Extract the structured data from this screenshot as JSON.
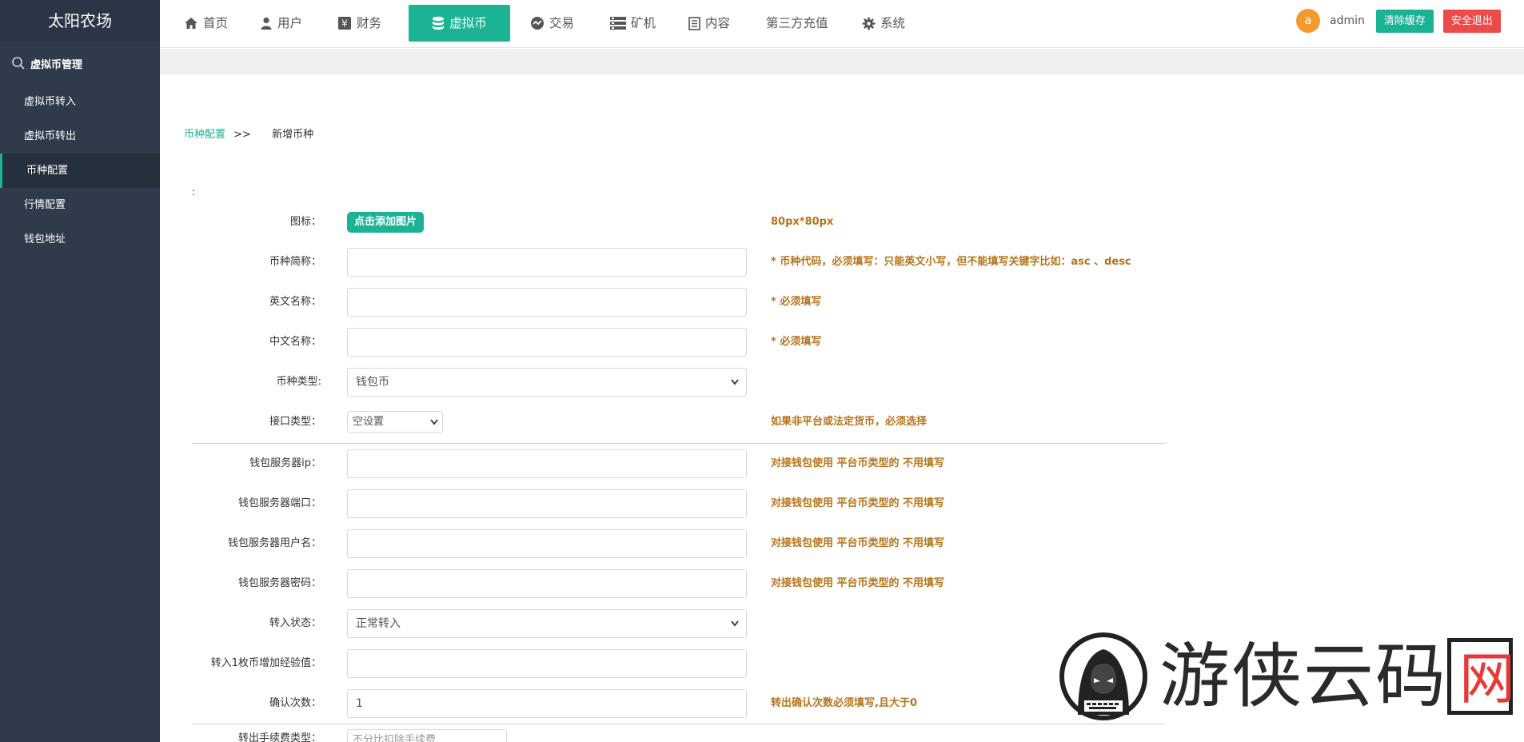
{
  "sidebar": {
    "logo": "太阳农场",
    "section_title": "虚拟币管理",
    "items": [
      {
        "label": "虚拟币转入"
      },
      {
        "label": "虚拟币转出"
      },
      {
        "label": "币种配置"
      },
      {
        "label": "行情配置"
      },
      {
        "label": "钱包地址"
      }
    ]
  },
  "topnav": {
    "items": [
      {
        "label": "首页",
        "icon": "home-icon"
      },
      {
        "label": "用户",
        "icon": "user-icon"
      },
      {
        "label": "财务",
        "icon": "yen-icon"
      },
      {
        "label": "虚拟币",
        "icon": "database-icon"
      },
      {
        "label": "交易",
        "icon": "exchange-icon"
      },
      {
        "label": "矿机",
        "icon": "server-icon"
      },
      {
        "label": "内容",
        "icon": "document-icon"
      },
      {
        "label": "第三方充值",
        "icon": ""
      },
      {
        "label": "系统",
        "icon": "gear-icon"
      }
    ],
    "active": "虚拟币",
    "avatar_letter": "a",
    "username": "admin",
    "clear_cache": "清除缓存",
    "logout": "安全退出"
  },
  "breadcrumb": {
    "link": "币种配置",
    "sep": ">>",
    "current": "新增币种"
  },
  "form": {
    "colon": ":",
    "icon_label": "图标：",
    "icon_button": "点击添加图片",
    "icon_hint": "80px*80px",
    "short_name_label": "币种简称：",
    "short_name_hint": "* 币种代码，必须填写：只能英文小写，但不能填写关键字比如：asc 、desc",
    "en_name_label": "英文名称：",
    "en_name_hint": "* 必须填写",
    "cn_name_label": "中文名称：",
    "cn_name_hint": "* 必须填写",
    "type_label": "币种类型:",
    "type_value": "钱包币",
    "api_label": "接口类型：",
    "api_value": "空设置",
    "api_hint": "如果非平台或法定货币，必须选择",
    "wallet_ip_label": "钱包服务器ip：",
    "wallet_ip_hint": "对接钱包使用 平台币类型的 不用填写",
    "wallet_port_label": "钱包服务器端口：",
    "wallet_port_hint": "对接钱包使用 平台币类型的 不用填写",
    "wallet_user_label": "钱包服务器用户名：",
    "wallet_user_hint": "对接钱包使用 平台币类型的 不用填写",
    "wallet_pass_label": "钱包服务器密码：",
    "wallet_pass_hint": "对接钱包使用 平台币类型的 不用填写",
    "in_status_label": "转入状态：",
    "in_status_value": "正常转入",
    "exp_label": "转入1枚币增加经验值：",
    "confirm_label": "确认次数：",
    "confirm_value": "1",
    "confirm_hint": "转出确认次数必须填写,且大于0",
    "fee_label": "转出手续费类型：",
    "fee_value": "不分比扣除手续费"
  },
  "watermark": {
    "text": "游侠云码",
    "last_char": "网"
  },
  "colors": {
    "accent": "#1bb394",
    "sidebar": "#2f3a4b",
    "danger": "#ed4a4a",
    "hint": "#b5741c"
  }
}
